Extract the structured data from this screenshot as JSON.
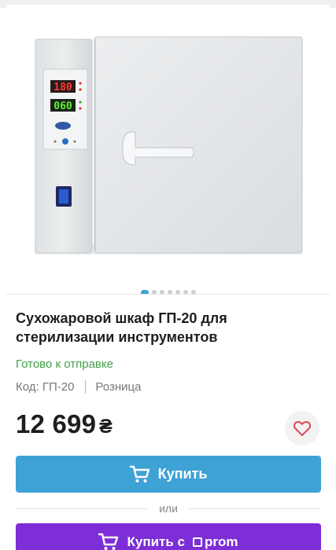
{
  "gallery": {
    "image_alt": "Сухожаровой шкаф ГП-20",
    "display_top": "180",
    "display_bottom": "060",
    "slide_count": 7,
    "active_slide": 1
  },
  "product": {
    "title": "Сухожаровой шкаф ГП-20 для стерилизации инструментов",
    "availability": "Готово к отправке",
    "code": "Код: ГП-20",
    "sale_type": "Розница",
    "price": "12 699",
    "currency": "₴"
  },
  "actions": {
    "buy_label": "Купить",
    "or_label": "или",
    "buy_prom_label": "Купить с",
    "prom_brand": "prom"
  },
  "colors": {
    "buy_button": "#3fa2d4",
    "prom_button": "#7d2ed6",
    "availability": "#43a047",
    "active_dot": "#3fa1d8",
    "heart": "#e0485c"
  },
  "icons": {
    "cart": "cart-icon",
    "heart": "heart-icon",
    "prom_logo": "prom-logo-icon"
  }
}
